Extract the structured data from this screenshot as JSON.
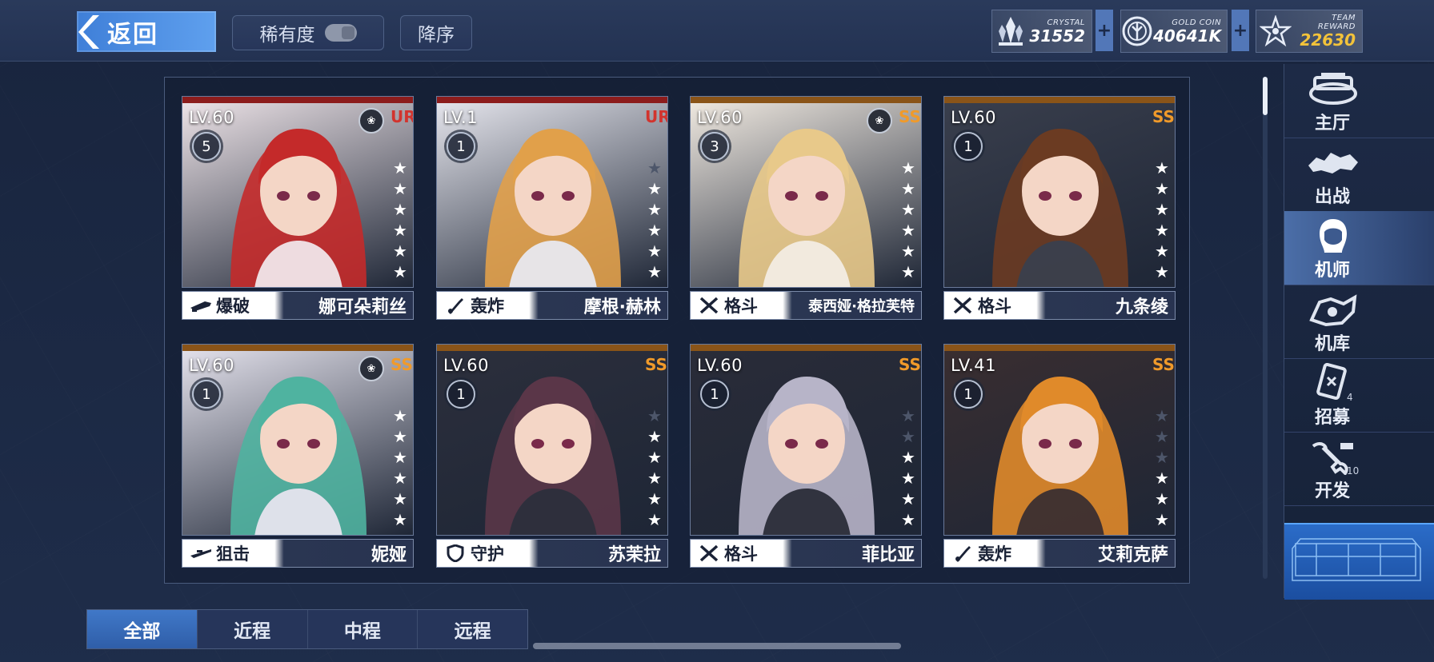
{
  "topbar": {
    "back_label": "返回",
    "rarity_label": "稀有度",
    "order_label": "降序",
    "resources": [
      {
        "caption": "CRYSTAL",
        "value": "31552",
        "icon": "crystal-icon"
      },
      {
        "caption": "GOLD COIN",
        "value": "40641K",
        "icon": "gold-coin-icon"
      },
      {
        "caption": "TEAM REWARD",
        "value": "22630",
        "icon": "team-reward-icon"
      }
    ],
    "plus": "+"
  },
  "cards": [
    {
      "level": "LV.60",
      "rank": "5",
      "rarity": "UR",
      "stars_on": 6,
      "stars_total": 6,
      "role": "爆破",
      "role_icon": "demolition-icon",
      "name": "娜可朵莉丝",
      "paw": true,
      "hair": "#c42a2a",
      "bg": "#f0e6ea",
      "stripe": "#8c1c1c"
    },
    {
      "level": "LV.1",
      "rank": "1",
      "rarity": "UR",
      "stars_on": 5,
      "stars_total": 6,
      "role": "轰炸",
      "role_icon": "bomber-icon",
      "name": "摩根·赫林",
      "paw": false,
      "hair": "#e1a04a",
      "bg": "#e8e8ef",
      "stripe": "#8c1c1c"
    },
    {
      "level": "LV.60",
      "rank": "3",
      "rarity": "SSR",
      "stars_on": 6,
      "stars_total": 6,
      "role": "格斗",
      "role_icon": "melee-icon",
      "name": "泰西娅·格拉芙特",
      "paw": true,
      "hair": "#e8c98a",
      "bg": "#f3ece3",
      "stripe": "#8a5418"
    },
    {
      "level": "LV.60",
      "rank": "1",
      "rarity": "SSR",
      "stars_on": 6,
      "stars_total": 6,
      "role": "格斗",
      "role_icon": "melee-icon",
      "name": "九条绫",
      "paw": false,
      "hair": "#6b3b22",
      "bg": "#3a3f4d",
      "stripe": "#8a5418"
    },
    {
      "level": "LV.60",
      "rank": "1",
      "rarity": "SSR",
      "stars_on": 6,
      "stars_total": 6,
      "role": "狙击",
      "role_icon": "sniper-icon",
      "name": "妮娅",
      "paw": true,
      "hair": "#4fb3a0",
      "bg": "#e6e4ee",
      "stripe": "#8a5418"
    },
    {
      "level": "LV.60",
      "rank": "1",
      "rarity": "SSR",
      "stars_on": 5,
      "stars_total": 6,
      "role": "守护",
      "role_icon": "guard-icon",
      "name": "苏茉拉",
      "paw": false,
      "hair": "#5a3648",
      "bg": "#2c2f3c",
      "stripe": "#8a5418"
    },
    {
      "level": "LV.60",
      "rank": "1",
      "rarity": "SSR",
      "stars_on": 4,
      "stars_total": 6,
      "role": "格斗",
      "role_icon": "melee-icon",
      "name": "菲比亚",
      "paw": false,
      "hair": "#b7b4c8",
      "bg": "#2a2c38",
      "stripe": "#8a5418"
    },
    {
      "level": "LV.41",
      "rank": "1",
      "rarity": "SSR",
      "stars_on": 3,
      "stars_total": 6,
      "role": "轰炸",
      "role_icon": "bomber-icon",
      "name": "艾莉克萨",
      "paw": false,
      "hair": "#e08a2a",
      "bg": "#3a2e30",
      "stripe": "#8a5418"
    }
  ],
  "sidebar": [
    {
      "label": "主厅",
      "icon": "main-hall-icon"
    },
    {
      "label": "出战",
      "icon": "sortie-icon"
    },
    {
      "label": "机师",
      "icon": "pilot-icon",
      "active": true
    },
    {
      "label": "机库",
      "icon": "hangar-icon"
    },
    {
      "label": "招募",
      "icon": "recruit-icon",
      "count": "4"
    },
    {
      "label": "开发",
      "icon": "develop-icon",
      "count": "10"
    }
  ],
  "tabs": [
    {
      "label": "全部",
      "active": true
    },
    {
      "label": "近程"
    },
    {
      "label": "中程"
    },
    {
      "label": "远程"
    }
  ],
  "colors": {
    "ur": "#d2342e",
    "ssr": "#f09a2a",
    "accent": "#3f7fd8",
    "reward": "#f3c33a"
  }
}
